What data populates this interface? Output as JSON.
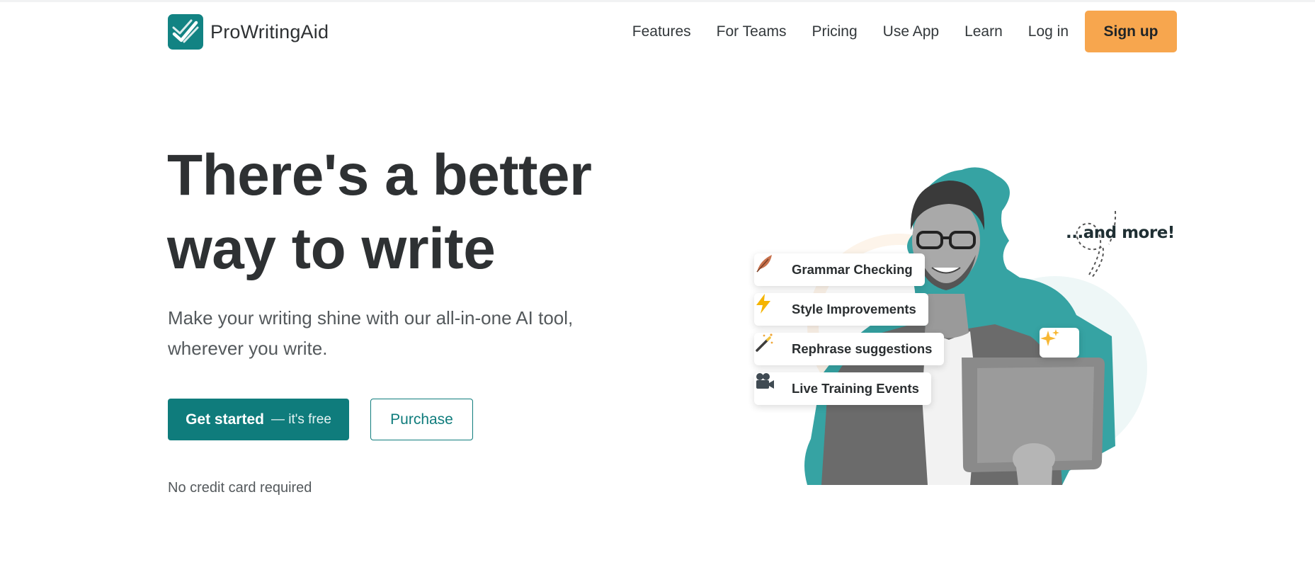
{
  "brand": {
    "name": "ProWritingAid"
  },
  "nav": {
    "items": [
      "Features",
      "For Teams",
      "Pricing",
      "Use App",
      "Learn",
      "Log in"
    ],
    "signup_label": "Sign up"
  },
  "hero": {
    "title_line1": "There's a better",
    "title_line2": "way to write",
    "subtitle": "Make your writing shine with our all-in-one AI tool, wherever you write.",
    "primary_cta": "Get started",
    "primary_cta_note": "— it's free",
    "secondary_cta": "Purchase",
    "footnote": "No credit card required"
  },
  "illustration": {
    "more_text": "...and more!",
    "features": [
      {
        "label": "Grammar Checking",
        "icon": "quill-icon"
      },
      {
        "label": "Style Improvements",
        "icon": "lightning-icon"
      },
      {
        "label": "Rephrase suggestions",
        "icon": "magic-wand-icon"
      },
      {
        "label": "Live Training Events",
        "icon": "video-camera-icon"
      }
    ],
    "sparkle_icon": "sparkles-icon"
  },
  "colors": {
    "brand_teal": "#0f7c7c",
    "signup_orange": "#f7a64e",
    "illustration_teal": "#36a3a3",
    "text_dark": "#2e3133"
  }
}
